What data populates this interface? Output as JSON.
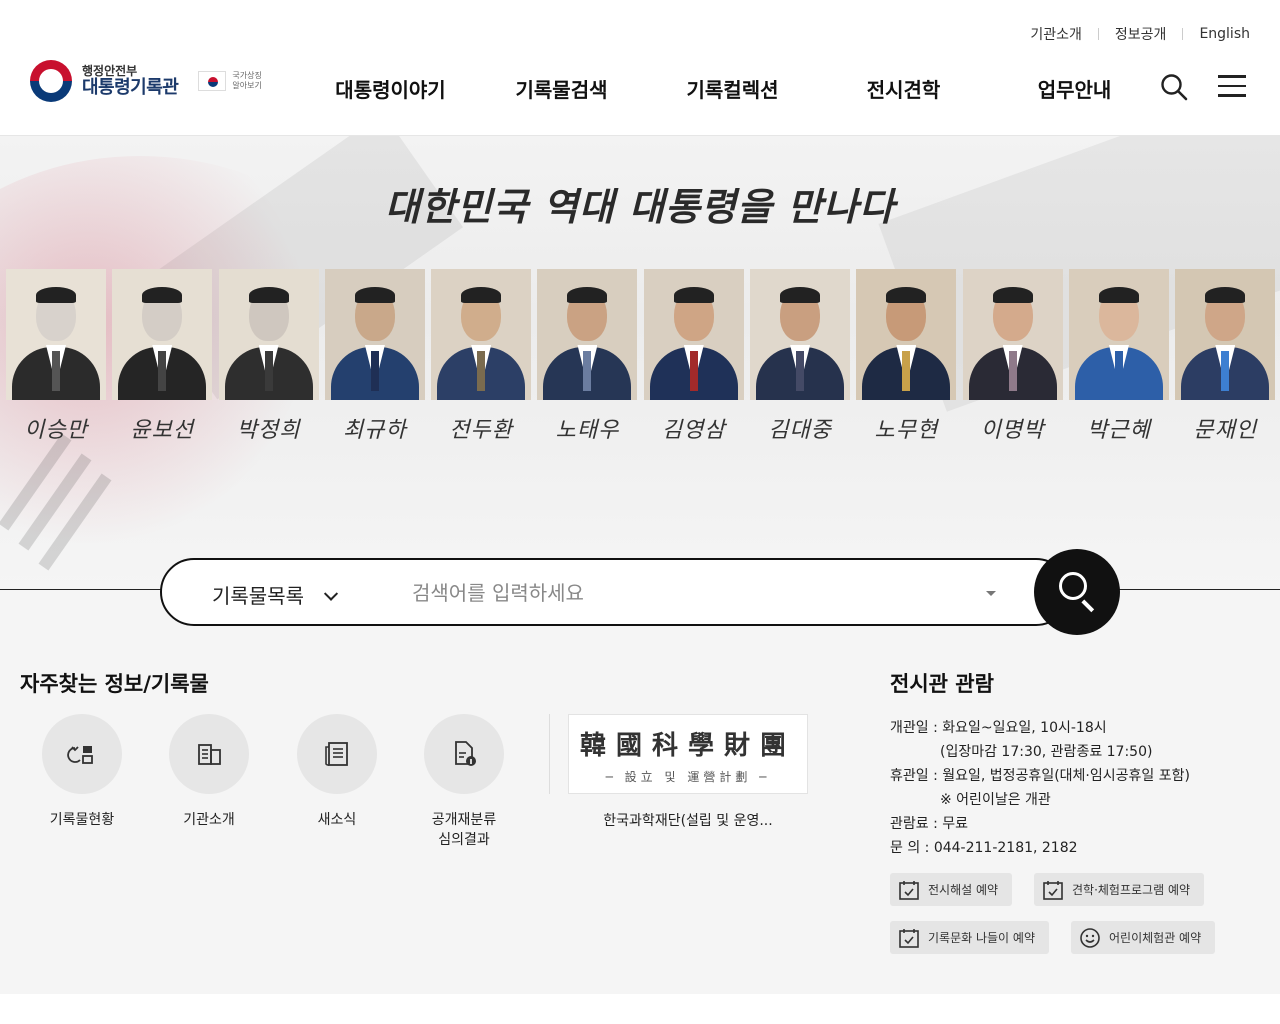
{
  "header": {
    "util_links": [
      "기관소개",
      "정보공개",
      "English"
    ],
    "logo_small": "행정안전부",
    "logo_big": "대통령기록관",
    "flag_text_1": "국가상징",
    "flag_text_2": "알아보기",
    "nav": [
      "대통령이야기",
      "기록물검색",
      "기록컬렉션",
      "전시견학",
      "업무안내"
    ]
  },
  "hero": {
    "title": "대한민국 역대 대통령을 만나다",
    "presidents": [
      {
        "signature": "이승만",
        "suit": "#2b2b2b",
        "tie": "#555",
        "skin": "#d8d2cc",
        "bg": "#e8e1d6"
      },
      {
        "signature": "윤보선",
        "suit": "#252525",
        "tie": "#444",
        "skin": "#d4cdc6",
        "bg": "#e6dfd3"
      },
      {
        "signature": "박정희",
        "suit": "#2e2e2e",
        "tie": "#3a3a3a",
        "skin": "#cfc7bf",
        "bg": "#e4ddd1"
      },
      {
        "signature": "최규하",
        "suit": "#24406e",
        "tie": "#1f2f55",
        "skin": "#c9a88a",
        "bg": "#d7cdbf"
      },
      {
        "signature": "전두환",
        "suit": "#2c3f66",
        "tie": "#7a6b4f",
        "skin": "#d0ad8c",
        "bg": "#dcd2c4"
      },
      {
        "signature": "노태우",
        "suit": "#263655",
        "tie": "#6b7da0",
        "skin": "#caa283",
        "bg": "#d8cebf"
      },
      {
        "signature": "김영삼",
        "suit": "#1f3158",
        "tie": "#a22a2a",
        "skin": "#cfa585",
        "bg": "#d9cfc1"
      },
      {
        "signature": "김대중",
        "suit": "#26324d",
        "tie": "#444a66",
        "skin": "#c99f80",
        "bg": "#e0d8cc"
      },
      {
        "signature": "노무현",
        "suit": "#1e2a44",
        "tie": "#c8a14a",
        "skin": "#c79a78",
        "bg": "#d6c8b4"
      },
      {
        "signature": "이명박",
        "suit": "#2a2a35",
        "tie": "#8f7a8a",
        "skin": "#d4aa8c",
        "bg": "#ddd3c6"
      },
      {
        "signature": "박근혜",
        "suit": "#2d5fa8",
        "tie": "#2d5fa8",
        "skin": "#dbb79c",
        "bg": "#d9cdbc"
      },
      {
        "signature": "문재인",
        "suit": "#2c3d63",
        "tie": "#3d7fd1",
        "skin": "#cfa688",
        "bg": "#d4c7b3"
      }
    ]
  },
  "search": {
    "category": "기록물목록",
    "placeholder": "검색어를 입력하세요"
  },
  "quick": {
    "title": "자주찾는 정보/기록물",
    "items": [
      {
        "label": "기록물현황",
        "icon": "records-status-icon"
      },
      {
        "label": "기관소개",
        "icon": "building-icon"
      },
      {
        "label": "새소식",
        "icon": "news-icon"
      },
      {
        "label": "공개재분류\n심의결과",
        "icon": "document-info-icon"
      }
    ],
    "featured": {
      "image_line1": "韓國科學財團",
      "image_line2": "─ 設立 및 運營計劃 ─",
      "caption": "한국과학재단(설립 및 운영..."
    }
  },
  "exhibition": {
    "title": "전시관 관람",
    "rows": [
      "개관일 : 화요일~일요일, 10시-18시",
      "(입장마감 17:30, 관람종료 17:50)",
      "휴관일 : 월요일, 법정공휴일(대체·임시공휴일 포함)",
      "※ 어린이날은 개관",
      "관람료 : 무료",
      "문     의 : 044-211-2181, 2182"
    ],
    "buttons": [
      "전시해설 예약",
      "견학·체험프로그램 예약",
      "기록문화 나들이 예약",
      "어린이체험관 예약"
    ]
  }
}
